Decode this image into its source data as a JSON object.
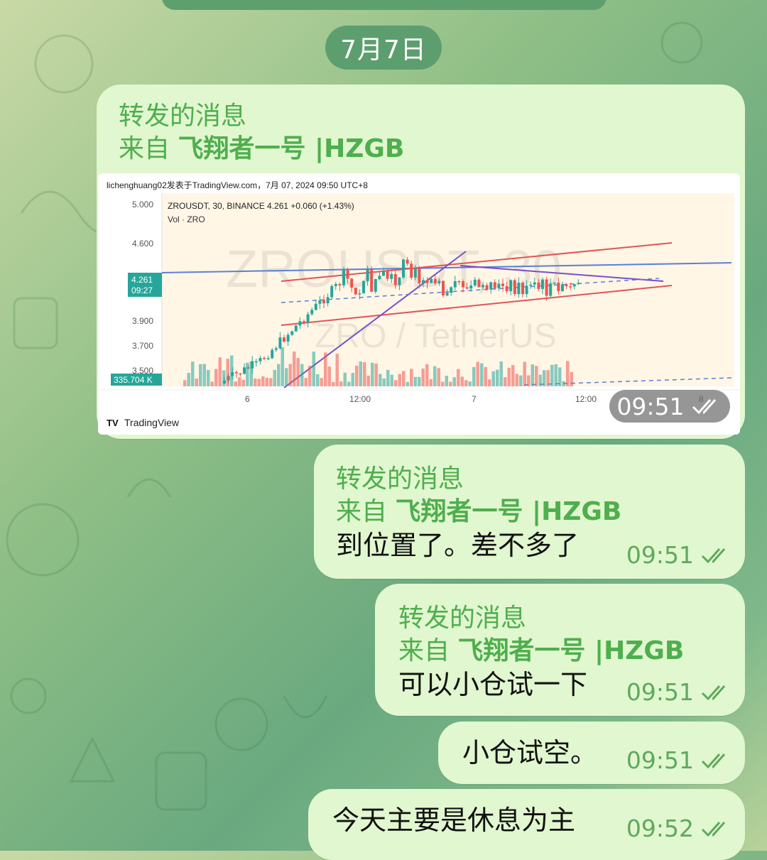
{
  "date_label": "7月7日",
  "messages": [
    {
      "forward_title": "转发的消息",
      "from_prefix": "来自",
      "from_name": "飞翔者一号 |HZGB",
      "time": "09:51",
      "chart": {
        "header": "lichenghuang02发表于TradingView.com，7月 07, 2024 09:50 UTC+8",
        "symbol_line": "ZROUSDT, 30, BINANCE  4.261  +0.060 (+1.43%)",
        "vol_line": "Vol · ZRO",
        "watermark": "ZROUSDT, 30",
        "watermark2": "ZRO / TetherUS",
        "price_tag": "4.261",
        "price_tag_time": "09:27",
        "volume_tag": "335.704 K",
        "y_ticks": [
          "5.000",
          "4.600",
          "3.900",
          "3.700",
          "3.500"
        ],
        "x_ticks": [
          "6",
          "12:00",
          "7",
          "12:00",
          "8"
        ],
        "logo_text": "TradingView"
      }
    },
    {
      "forward_title": "转发的消息",
      "from_prefix": "来自",
      "from_name": "飞翔者一号 |HZGB",
      "text": "到位置了。差不多了",
      "time": "09:51"
    },
    {
      "forward_title": "转发的消息",
      "from_prefix": "来自",
      "from_name": "飞翔者一号 |HZGB",
      "text": "可以小仓试一下",
      "time": "09:51"
    },
    {
      "text": "小仓试空。",
      "time": "09:51"
    },
    {
      "text": "今天主要是休息为主",
      "time": "09:52"
    }
  ],
  "colors": {
    "bubble": "#e1f7cf",
    "accent_green": "#4fae4e",
    "date_pill": "#5d9e6e",
    "candle_up": "#26a69a",
    "candle_down": "#ef5350"
  }
}
